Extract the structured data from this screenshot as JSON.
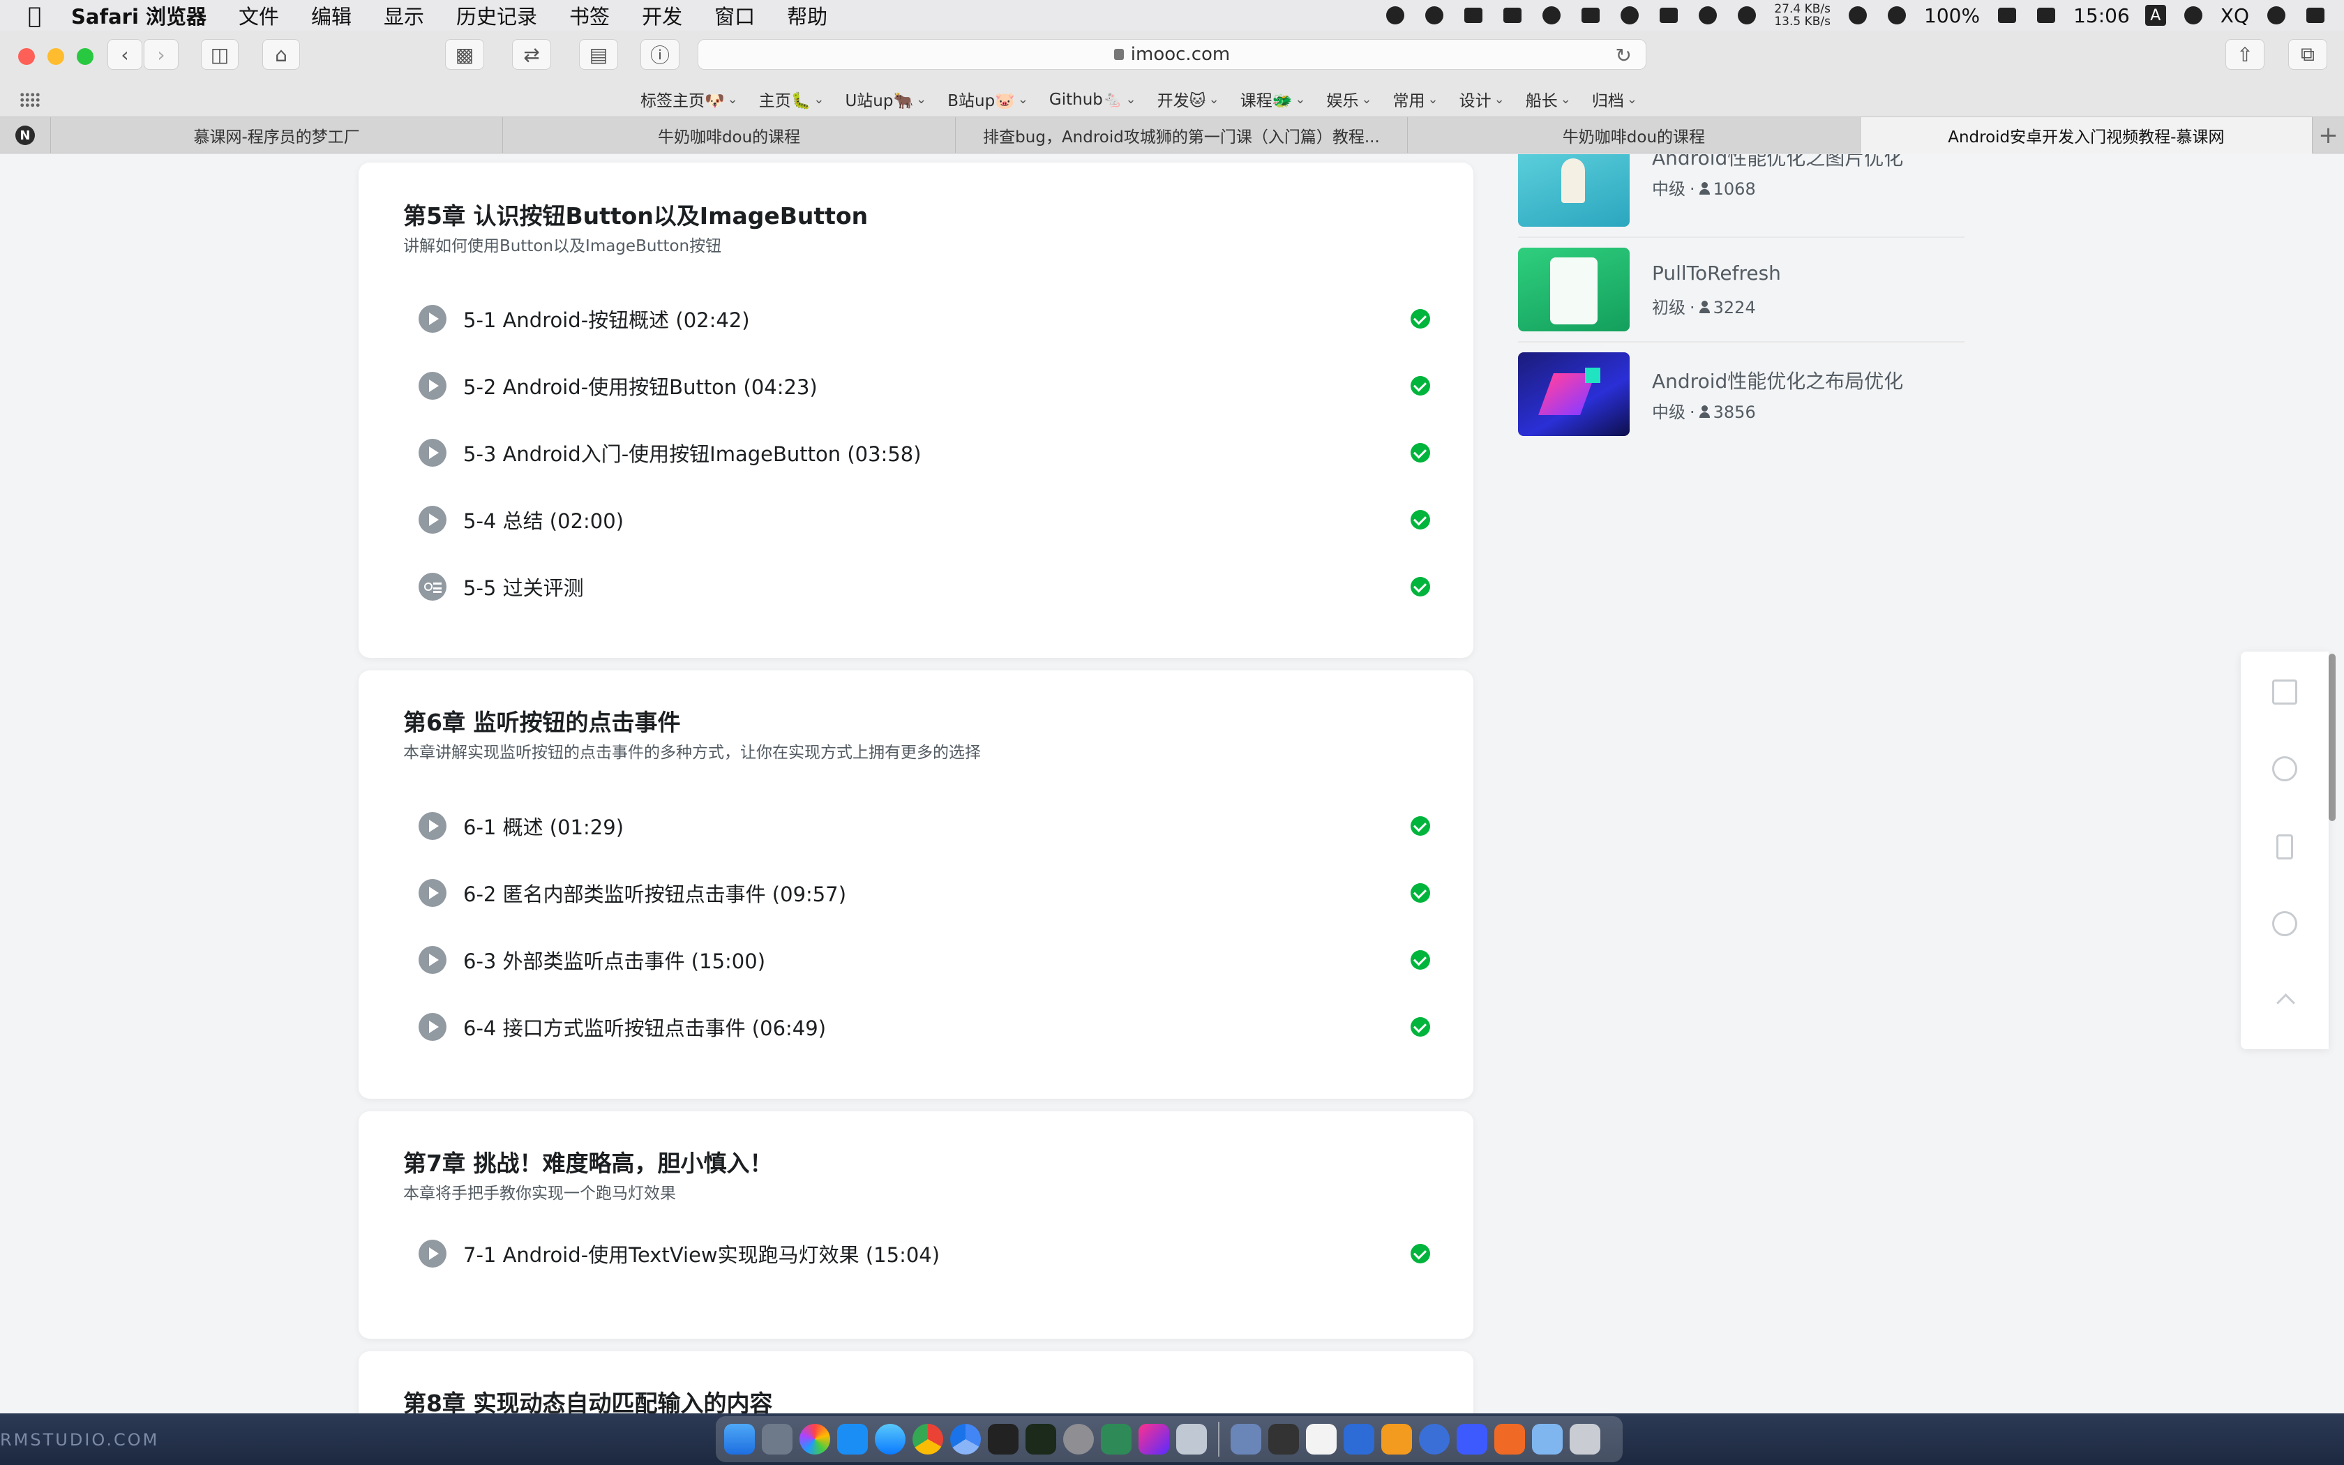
{
  "menubar": {
    "app_name": "Safari 浏览器",
    "items": [
      "文件",
      "编辑",
      "显示",
      "历史记录",
      "书签",
      "开发",
      "窗口",
      "帮助"
    ],
    "net_up": "27.4 KB/s",
    "net_down": "13.5 KB/s",
    "battery": "100%",
    "time": "15:06",
    "ime": "A",
    "user": "XQ"
  },
  "toolbar": {
    "url": "imooc.com",
    "favorites": [
      {
        "label": "标签主页🐶"
      },
      {
        "label": "主页🐛"
      },
      {
        "label": "U站up🐂"
      },
      {
        "label": "B站up🐷"
      },
      {
        "label": "Github🐁"
      },
      {
        "label": "开发🐱"
      },
      {
        "label": "课程🐲"
      },
      {
        "label": "娱乐"
      },
      {
        "label": "常用"
      },
      {
        "label": "设计"
      },
      {
        "label": "船长"
      },
      {
        "label": "归档"
      }
    ]
  },
  "tabs": [
    {
      "title": "慕课网-程序员的梦工厂"
    },
    {
      "title": "牛奶咖啡dou的课程"
    },
    {
      "title": "排查bug，Android攻城狮的第一门课（入门篇）教程..."
    },
    {
      "title": "牛奶咖啡dou的课程"
    },
    {
      "title": "Android安卓开发入门视频教程-慕课网"
    }
  ],
  "chapters": [
    {
      "title": "第5章 认识按钮Button以及ImageButton",
      "desc": "讲解如何使用Button以及ImageButton按钮",
      "lessons": [
        {
          "label": "5-1 Android-按钮概述 (02:42)",
          "type": "video"
        },
        {
          "label": "5-2 Android-使用按钮Button (04:23)",
          "type": "video"
        },
        {
          "label": "5-3 Android入门-使用按钮ImageButton (03:58)",
          "type": "video"
        },
        {
          "label": "5-4 总结 (02:00)",
          "type": "video"
        },
        {
          "label": "5-5 过关评测",
          "type": "quiz"
        }
      ]
    },
    {
      "title": "第6章 监听按钮的点击事件",
      "desc": "本章讲解实现监听按钮的点击事件的多种方式，让你在实现方式上拥有更多的选择",
      "lessons": [
        {
          "label": "6-1 概述 (01:29)",
          "type": "video"
        },
        {
          "label": "6-2 匿名内部类监听按钮点击事件 (09:57)",
          "type": "video"
        },
        {
          "label": "6-3 外部类监听点击事件 (15:00)",
          "type": "video"
        },
        {
          "label": "6-4 接口方式监听按钮点击事件 (06:49)",
          "type": "video"
        }
      ]
    },
    {
      "title": "第7章 挑战！难度略高，胆小慎入！",
      "desc": "本章将手把手教你实现一个跑马灯效果",
      "lessons": [
        {
          "label": "7-1 Android-使用TextView实现跑马灯效果 (15:04)",
          "type": "video"
        }
      ]
    },
    {
      "title": "第8章 实现动态自动匹配输入的内容"
    }
  ],
  "recommended": [
    {
      "title": "Android性能优化之图片优化",
      "level": "中级",
      "learners": "1068"
    },
    {
      "title": "PullToRefresh",
      "level": "初级",
      "learners": "3224"
    },
    {
      "title": "Android性能优化之布局优化",
      "level": "中级",
      "learners": "3856"
    }
  ],
  "watermark": "RMSTUDIO.COM",
  "colors": {
    "completed": "#00b43c",
    "play_icon": "#9199a1",
    "page_bg": "#f3f4f6"
  }
}
